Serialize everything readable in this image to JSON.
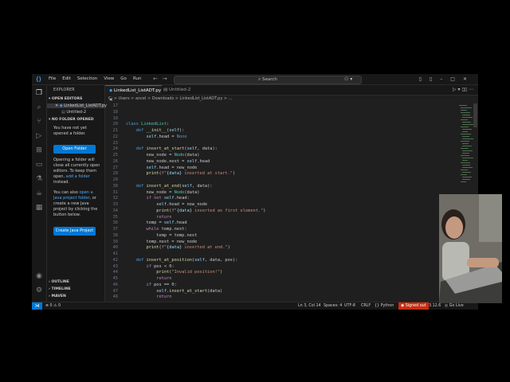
{
  "menu": [
    "File",
    "Edit",
    "Selection",
    "View",
    "Go",
    "Run"
  ],
  "search": {
    "placeholder": "Search"
  },
  "sidebar": {
    "header": "EXPLORER",
    "open_editors": "OPEN EDITORS",
    "open_files": [
      "LinkedList_ListADT.py",
      "Untitled-2"
    ],
    "no_folder": "NO FOLDER OPENED",
    "no_folder_text": "You have not yet opened a folder.",
    "open_folder_btn": "Open Folder",
    "hint1_a": "Opening a folder will close all currently open editors. To keep them open, ",
    "hint1_link": "add a folder",
    "hint1_b": " instead.",
    "hint2_a": "You can also ",
    "hint2_link": "open a Java project folder",
    "hint2_b": ", or create a new Java project by clicking the button below.",
    "java_btn": "Create Java Project",
    "outline": "OUTLINE",
    "timeline": "TIMELINE",
    "maven": "MAVEN"
  },
  "tabs": [
    "LinkedList_ListADT.py",
    "Untitled-2"
  ],
  "breadcrumb": "C: > Users > ancel > Downloads > LinkedList_ListADT.py > ...",
  "code": {
    "line_numbers": [
      "17",
      "18",
      "19",
      "20",
      "21",
      "22",
      "23",
      "24",
      "25",
      "26",
      "27",
      "28",
      "29",
      "30",
      "31",
      "32",
      "33",
      "34",
      "35",
      "36",
      "37",
      "38",
      "39",
      "40",
      "41",
      "42",
      "43",
      "44",
      "45",
      "46",
      "47",
      "48"
    ]
  },
  "status": {
    "problems": "⊗ 0 ⚠ 0",
    "cursor": "Ln 3, Col 14",
    "spaces": "Spaces: 4",
    "encoding": "UTF-8",
    "eol": "CRLF",
    "language": "Python",
    "signed": "Signed out",
    "version": "3.12.6",
    "golive": "Go Live"
  },
  "colors": {
    "accent": "#0078d4",
    "background": "#1f1f1f",
    "signed_out": "#c72e0f"
  }
}
